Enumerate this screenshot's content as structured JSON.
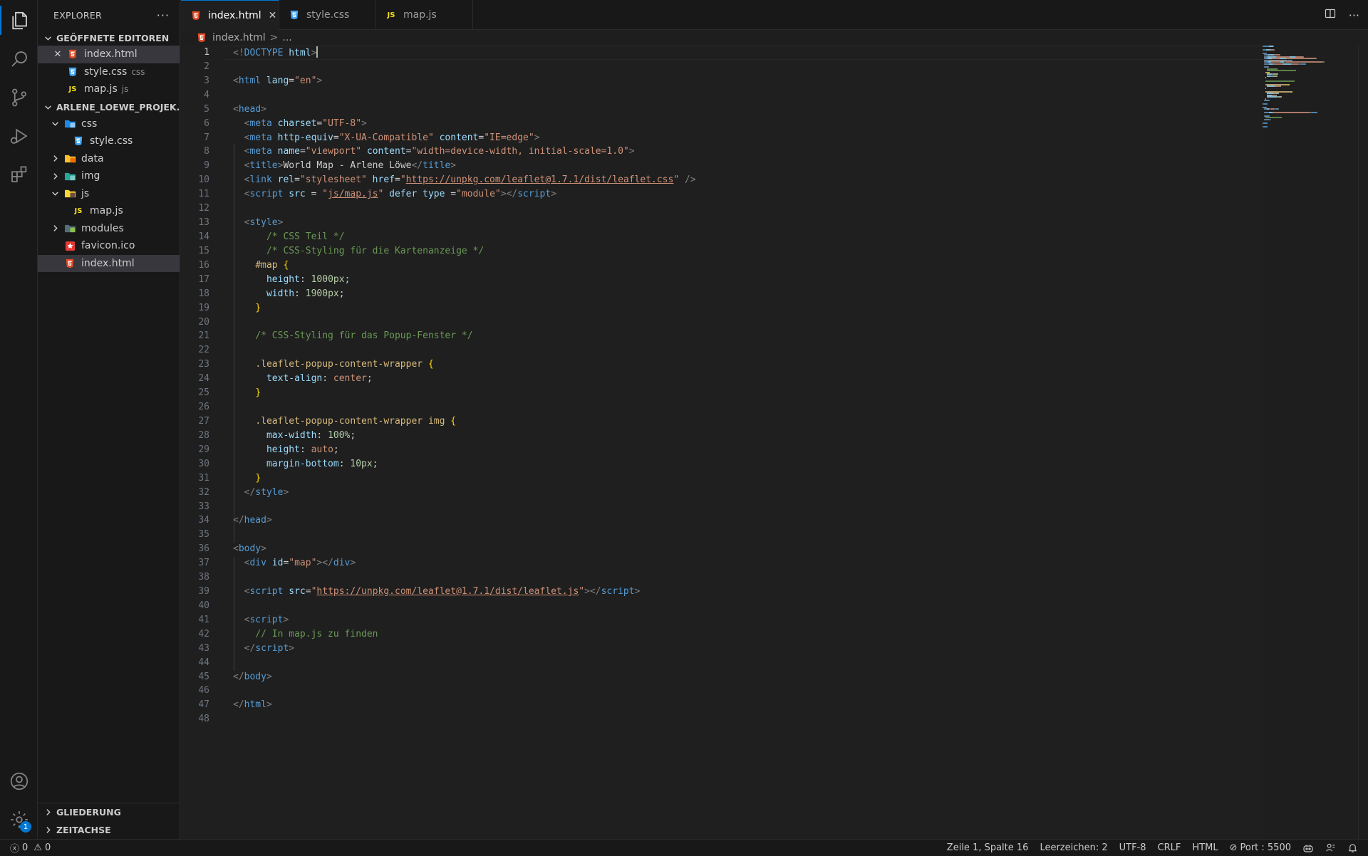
{
  "activity_bar": {
    "items": [
      {
        "name": "explorer-icon",
        "active": true
      },
      {
        "name": "search-icon",
        "active": false
      },
      {
        "name": "source-control-icon",
        "active": false
      },
      {
        "name": "run-debug-icon",
        "active": false
      },
      {
        "name": "extensions-icon",
        "active": false
      }
    ],
    "bottom": [
      {
        "name": "account-icon"
      },
      {
        "name": "settings-gear-icon",
        "badge": "1"
      }
    ]
  },
  "sidebar": {
    "title": "EXPLORER",
    "more": "···",
    "open_editors_title": "GEÖFFNETE EDITOREN",
    "open_editors": [
      {
        "label": "index.html",
        "suffix": "",
        "icon": "html"
      },
      {
        "label": "style.css",
        "suffix": "css",
        "icon": "css"
      },
      {
        "label": "map.js",
        "suffix": "js",
        "icon": "js"
      }
    ],
    "project_title": "ARLENE_LOEWE_PROJEK...",
    "tree": [
      {
        "label": "css",
        "type": "folder-open",
        "icon": "css-folder"
      },
      {
        "label": "style.css",
        "type": "file",
        "icon": "css"
      },
      {
        "label": "data",
        "type": "folder",
        "icon": "data-folder"
      },
      {
        "label": "img",
        "type": "folder",
        "icon": "img-folder"
      },
      {
        "label": "js",
        "type": "folder-open",
        "icon": "js-folder"
      },
      {
        "label": "map.js",
        "type": "file",
        "icon": "js"
      },
      {
        "label": "modules",
        "type": "folder",
        "icon": "modules-folder"
      },
      {
        "label": "favicon.ico",
        "type": "file",
        "icon": "favicon"
      },
      {
        "label": "index.html",
        "type": "file",
        "icon": "html"
      }
    ],
    "outline_title": "GLIEDERUNG",
    "timeline_title": "ZEITACHSE"
  },
  "tabs": [
    {
      "label": "index.html",
      "icon": "html",
      "active": true
    },
    {
      "label": "style.css",
      "icon": "css",
      "active": false
    },
    {
      "label": "map.js",
      "icon": "js",
      "active": false
    }
  ],
  "breadcrumb": {
    "file": "index.html",
    "sep": ">",
    "more": "..."
  },
  "editor": {
    "current_line": 1,
    "lines": [
      [
        [
          "pu",
          "<!"
        ],
        [
          "tg",
          "DOCTYPE"
        ],
        [
          "",
          ""
        ],
        [
          "at",
          " html"
        ],
        [
          "pu",
          ">"
        ]
      ],
      [],
      [
        [
          "pu",
          "<"
        ],
        [
          "tg",
          "html"
        ],
        [
          "at",
          " lang"
        ],
        [
          "",
          "="
        ],
        [
          "st",
          "\"en\""
        ],
        [
          "pu",
          ">"
        ]
      ],
      [],
      [
        [
          "pu",
          "<"
        ],
        [
          "tg",
          "head"
        ],
        [
          "pu",
          ">"
        ]
      ],
      [
        [
          "",
          "  "
        ],
        [
          "pu",
          "<"
        ],
        [
          "tg",
          "meta"
        ],
        [
          "at",
          " charset"
        ],
        [
          "",
          "="
        ],
        [
          "st",
          "\"UTF-8\""
        ],
        [
          "pu",
          ">"
        ]
      ],
      [
        [
          "",
          "  "
        ],
        [
          "pu",
          "<"
        ],
        [
          "tg",
          "meta"
        ],
        [
          "at",
          " http-equiv"
        ],
        [
          "",
          "="
        ],
        [
          "st",
          "\"X-UA-Compatible\""
        ],
        [
          "at",
          " content"
        ],
        [
          "",
          "="
        ],
        [
          "st",
          "\"IE=edge\""
        ],
        [
          "pu",
          ">"
        ]
      ],
      [
        [
          "",
          "  "
        ],
        [
          "pu",
          "<"
        ],
        [
          "tg",
          "meta"
        ],
        [
          "at",
          " name"
        ],
        [
          "",
          "="
        ],
        [
          "st",
          "\"viewport\""
        ],
        [
          "at",
          " content"
        ],
        [
          "",
          "="
        ],
        [
          "st",
          "\"width=device-width, initial-scale=1.0\""
        ],
        [
          "pu",
          ">"
        ]
      ],
      [
        [
          "",
          "  "
        ],
        [
          "pu",
          "<"
        ],
        [
          "tg",
          "title"
        ],
        [
          "pu",
          ">"
        ],
        [
          "",
          "World Map - Arlene Löwe"
        ],
        [
          "pu",
          "</"
        ],
        [
          "tg",
          "title"
        ],
        [
          "pu",
          ">"
        ]
      ],
      [
        [
          "",
          "  "
        ],
        [
          "pu",
          "<"
        ],
        [
          "tg",
          "link"
        ],
        [
          "at",
          " rel"
        ],
        [
          "",
          "="
        ],
        [
          "st",
          "\"stylesheet\""
        ],
        [
          "at",
          " href"
        ],
        [
          "",
          "="
        ],
        [
          "st",
          "\""
        ],
        [
          "st ul",
          "https://unpkg.com/leaflet@1.7.1/dist/leaflet.css"
        ],
        [
          "st",
          "\""
        ],
        [
          "pu",
          " />"
        ]
      ],
      [
        [
          "",
          "  "
        ],
        [
          "pu",
          "<"
        ],
        [
          "tg",
          "script"
        ],
        [
          "at",
          " src"
        ],
        [
          "",
          " = "
        ],
        [
          "st",
          "\""
        ],
        [
          "st ul",
          "js/map.js"
        ],
        [
          "st",
          "\""
        ],
        [
          "at",
          " defer"
        ],
        [
          "at",
          " type"
        ],
        [
          "",
          " ="
        ],
        [
          "st",
          "\"module\""
        ],
        [
          "pu",
          "></"
        ],
        [
          "tg",
          "script"
        ],
        [
          "pu",
          ">"
        ]
      ],
      [],
      [
        [
          "",
          "  "
        ],
        [
          "pu",
          "<"
        ],
        [
          "tg",
          "style"
        ],
        [
          "pu",
          ">"
        ]
      ],
      [
        [
          "",
          "      "
        ],
        [
          "cm",
          "/* CSS Teil */"
        ]
      ],
      [
        [
          "",
          "      "
        ],
        [
          "cm",
          "/* CSS-Styling für die Kartenanzeige */"
        ]
      ],
      [
        [
          "",
          "    "
        ],
        [
          "sel",
          "#map"
        ],
        [
          "br",
          " {"
        ]
      ],
      [
        [
          "",
          "      "
        ],
        [
          "at",
          "height"
        ],
        [
          "",
          ": "
        ],
        [
          "nu",
          "1000px"
        ],
        [
          "",
          ";"
        ]
      ],
      [
        [
          "",
          "      "
        ],
        [
          "at",
          "width"
        ],
        [
          "",
          ": "
        ],
        [
          "nu",
          "1900px"
        ],
        [
          "",
          ";"
        ]
      ],
      [
        [
          "",
          "    "
        ],
        [
          "br",
          "}"
        ]
      ],
      [],
      [
        [
          "",
          "    "
        ],
        [
          "cm",
          "/* CSS-Styling für das Popup-Fenster */"
        ]
      ],
      [],
      [
        [
          "",
          "    "
        ],
        [
          "sel",
          ".leaflet-popup-content-wrapper"
        ],
        [
          "br",
          " {"
        ]
      ],
      [
        [
          "",
          "      "
        ],
        [
          "at",
          "text-align"
        ],
        [
          "",
          ": "
        ],
        [
          "st",
          "center"
        ],
        [
          "",
          ";"
        ]
      ],
      [
        [
          "",
          "    "
        ],
        [
          "br",
          "}"
        ]
      ],
      [],
      [
        [
          "",
          "    "
        ],
        [
          "sel",
          ".leaflet-popup-content-wrapper img"
        ],
        [
          "br",
          " {"
        ]
      ],
      [
        [
          "",
          "      "
        ],
        [
          "at",
          "max-width"
        ],
        [
          "",
          ": "
        ],
        [
          "nu",
          "100%"
        ],
        [
          "",
          ";"
        ]
      ],
      [
        [
          "",
          "      "
        ],
        [
          "at",
          "height"
        ],
        [
          "",
          ": "
        ],
        [
          "st",
          "auto"
        ],
        [
          "",
          ";"
        ]
      ],
      [
        [
          "",
          "      "
        ],
        [
          "at",
          "margin-bottom"
        ],
        [
          "",
          ": "
        ],
        [
          "nu",
          "10px"
        ],
        [
          "",
          ";"
        ]
      ],
      [
        [
          "",
          "    "
        ],
        [
          "br",
          "}"
        ]
      ],
      [
        [
          "",
          "  "
        ],
        [
          "pu",
          "</"
        ],
        [
          "tg",
          "style"
        ],
        [
          "pu",
          ">"
        ]
      ],
      [],
      [
        [
          "pu",
          "</"
        ],
        [
          "tg",
          "head"
        ],
        [
          "pu",
          ">"
        ]
      ],
      [],
      [
        [
          "pu",
          "<"
        ],
        [
          "tg",
          "body"
        ],
        [
          "pu",
          ">"
        ]
      ],
      [
        [
          "",
          "  "
        ],
        [
          "pu",
          "<"
        ],
        [
          "tg",
          "div"
        ],
        [
          "at",
          " id"
        ],
        [
          "",
          "="
        ],
        [
          "st",
          "\"map\""
        ],
        [
          "pu",
          "></"
        ],
        [
          "tg",
          "div"
        ],
        [
          "pu",
          ">"
        ]
      ],
      [],
      [
        [
          "",
          "  "
        ],
        [
          "pu",
          "<"
        ],
        [
          "tg",
          "script"
        ],
        [
          "at",
          " src"
        ],
        [
          "",
          "="
        ],
        [
          "st",
          "\""
        ],
        [
          "st ul",
          "https://unpkg.com/leaflet@1.7.1/dist/leaflet.js"
        ],
        [
          "st",
          "\""
        ],
        [
          "pu",
          "></"
        ],
        [
          "tg",
          "script"
        ],
        [
          "pu",
          ">"
        ]
      ],
      [],
      [
        [
          "",
          "  "
        ],
        [
          "pu",
          "<"
        ],
        [
          "tg",
          "script"
        ],
        [
          "pu",
          ">"
        ]
      ],
      [
        [
          "",
          "    "
        ],
        [
          "cm",
          "// In map.js zu finden"
        ]
      ],
      [
        [
          "",
          "  "
        ],
        [
          "pu",
          "</"
        ],
        [
          "tg",
          "script"
        ],
        [
          "pu",
          ">"
        ]
      ],
      [],
      [
        [
          "pu",
          "</"
        ],
        [
          "tg",
          "body"
        ],
        [
          "pu",
          ">"
        ]
      ],
      [],
      [
        [
          "pu",
          "</"
        ],
        [
          "tg",
          "html"
        ],
        [
          "pu",
          ">"
        ]
      ],
      []
    ]
  },
  "statusbar": {
    "errors": "0",
    "warnings": "0",
    "position": "Zeile 1, Spalte 16",
    "indent": "Leerzeichen: 2",
    "encoding": "UTF-8",
    "eol": "CRLF",
    "language": "HTML",
    "port": "Port : 5500"
  },
  "colors": {
    "accent": "#0078d4",
    "html_icon": "#e44d26",
    "css_icon": "#42a5f5",
    "js_icon": "#f5de19"
  }
}
